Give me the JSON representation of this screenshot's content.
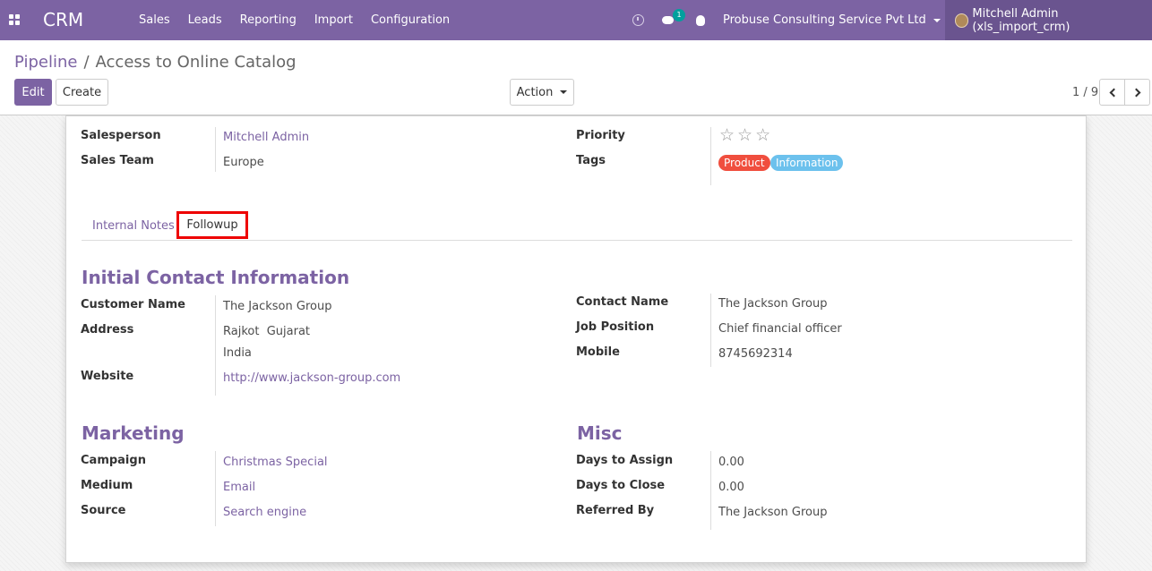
{
  "nav": {
    "brand": "CRM",
    "menu": [
      "Sales",
      "Leads",
      "Reporting",
      "Import",
      "Configuration"
    ],
    "chat_count": "1",
    "company": "Probuse Consulting Service Pvt Ltd",
    "user": "Mitchell Admin (xls_import_crm)",
    "accent": "#7c63a3"
  },
  "breadcrumb": {
    "parent": "Pipeline",
    "separator": "/",
    "current": "Access to Online Catalog"
  },
  "toolbar": {
    "edit": "Edit",
    "create": "Create",
    "action": "Action"
  },
  "pager": {
    "value": "1 / 9"
  },
  "form": {
    "salesperson_label": "Salesperson",
    "salesperson": "Mitchell Admin",
    "sales_team_label": "Sales Team",
    "sales_team": "Europe",
    "priority_label": "Priority",
    "priority_stars": [
      "☆",
      "☆",
      "☆"
    ],
    "tags_label": "Tags",
    "tags": [
      "Product",
      "Information"
    ]
  },
  "tabs": {
    "internal_notes": "Internal Notes",
    "followup": "Followup"
  },
  "contact": {
    "title": "Initial Contact Information",
    "customer_name_label": "Customer Name",
    "customer_name": "The Jackson Group",
    "address_label": "Address",
    "address_line1": "Rajkot  Gujarat",
    "address_line2": "India",
    "website_label": "Website",
    "website": "http://www.jackson-group.com",
    "contact_name_label": "Contact Name",
    "contact_name": "The Jackson Group",
    "job_position_label": "Job Position",
    "job_position": "Chief financial officer",
    "mobile_label": "Mobile",
    "mobile": "8745692314"
  },
  "marketing": {
    "title": "Marketing",
    "campaign_label": "Campaign",
    "campaign": "Christmas Special",
    "medium_label": "Medium",
    "medium": "Email",
    "source_label": "Source",
    "source": "Search engine"
  },
  "misc": {
    "title": "Misc",
    "days_to_assign_label": "Days to Assign",
    "days_to_assign": "0.00",
    "days_to_close_label": "Days to Close",
    "days_to_close": "0.00",
    "referred_by_label": "Referred By",
    "referred_by": "The Jackson Group"
  }
}
